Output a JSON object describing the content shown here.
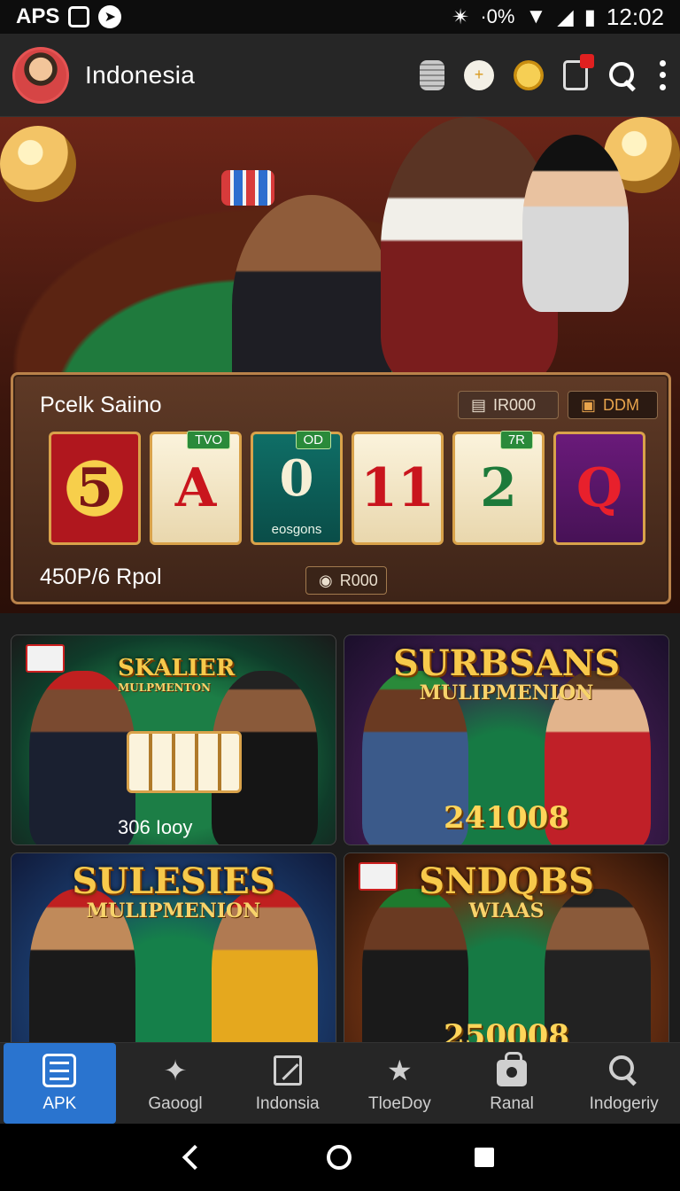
{
  "status_bar": {
    "left_text": "APS",
    "signal_text": "·0%",
    "time": "12:02"
  },
  "app_bar": {
    "title": "Indonesia",
    "plus_symbol": "+"
  },
  "slot_panel": {
    "title": "Pcelk Saiino",
    "chip_1": "IR000",
    "chip_2": "DDM",
    "bet_text": "450P/6 Rpol",
    "bottom_chip": "R000",
    "reels": [
      {
        "symbol": "5",
        "tag": ""
      },
      {
        "symbol": "A",
        "tag": "TVO"
      },
      {
        "symbol": "0",
        "tag": "OD",
        "sub": "eosgons"
      },
      {
        "symbol": "11",
        "tag": ""
      },
      {
        "symbol": "2",
        "tag": "7R"
      },
      {
        "symbol": "Q",
        "tag": ""
      }
    ]
  },
  "game_cards": [
    {
      "title": "SKALIER",
      "subtitle": "MULPMENTON",
      "value": "306 Iooy"
    },
    {
      "title": "SURBSANS",
      "subtitle": "MULIPMENION",
      "value": "241008"
    },
    {
      "title": "SULESIES",
      "subtitle": "MULIPMENION",
      "value": ""
    },
    {
      "title": "SNDQBS",
      "subtitle": "WIAAS",
      "value": "250008"
    }
  ],
  "bottom_nav": [
    {
      "label": "APK",
      "icon": "list-icon",
      "active": true
    },
    {
      "label": "Gaoogl",
      "icon": "sparkle-icon",
      "active": false
    },
    {
      "label": "Indonsia",
      "icon": "draw-icon",
      "active": false
    },
    {
      "label": "TloeDoy",
      "icon": "star-icon",
      "active": false
    },
    {
      "label": "Ranal",
      "icon": "bag-icon",
      "active": false
    },
    {
      "label": "Indogeriy",
      "icon": "search-icon",
      "active": false
    }
  ],
  "colors": {
    "accent": "#2a74cf",
    "panel_border": "#b9824a",
    "title_gold": "#f7c94b"
  }
}
